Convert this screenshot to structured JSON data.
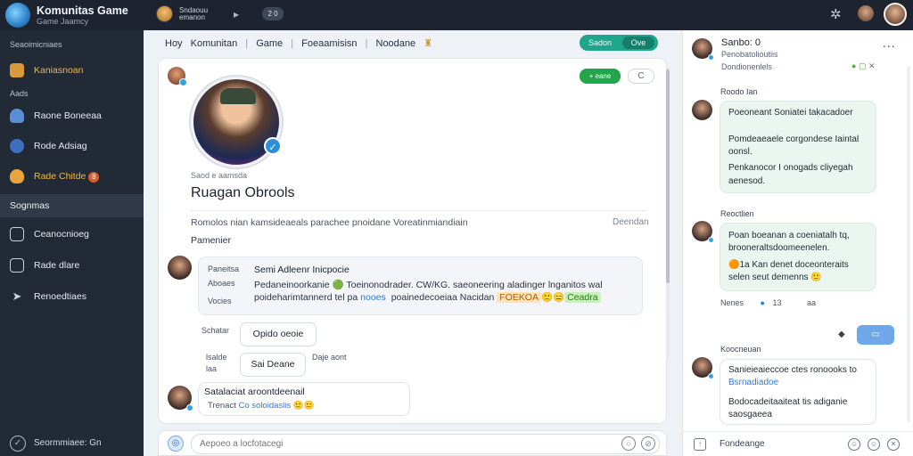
{
  "app": {
    "title": "Komunitas Game",
    "subtitle": "Game Jaamcy"
  },
  "topbar": {
    "user_line1": "Sndaouu",
    "user_line2": "emanon",
    "pill": "2 0"
  },
  "sidebar": {
    "section1": "Seaoimicniaes",
    "items1": [
      {
        "label": "Kaniasnoan",
        "icon": "controller-icon"
      }
    ],
    "section2": "Aads",
    "items2": [
      {
        "label": "Raone Boneeaa",
        "icon": "rocket-icon"
      },
      {
        "label": "Rode Adsiag",
        "icon": "globe-icon"
      },
      {
        "label": "Rade Chitde",
        "icon": "fire-icon",
        "badge": "8"
      }
    ],
    "active": "Sognmas",
    "items3": [
      {
        "label": "Ceanocnioeg",
        "icon": "monitor-icon"
      },
      {
        "label": "Rade dlare",
        "icon": "edit-icon"
      },
      {
        "label": "Renoedtiaes",
        "icon": "send-icon"
      }
    ],
    "footer": "Seormmiaee: Gn"
  },
  "breadcrumbs": [
    "Hoy",
    "Komunitan",
    "Game",
    "Foeaamisisn",
    "Noodane"
  ],
  "header_button": {
    "label": "Sadon",
    "split": "Ove"
  },
  "main": {
    "btn_green": "+ eane",
    "btn_refresh": "C",
    "room_meta": "Saod e aamsda",
    "room_title": "Ruagan Obrools",
    "room_desc": "Romolos nian kamsideaeals parachee pnoidane Voreatinmiandiain",
    "room_desc_right": "Deendan",
    "section": "Pamenier",
    "message1": {
      "side": [
        "Paneitsa",
        "Aboaes",
        "Vocies"
      ],
      "title": "Semi Adleenr Inicpocie",
      "line1": "Pedaneinoorkanie 🟢 Toeinonodrader. CW/KG. saeoneering aladinger lnganitos wal",
      "line2_pre": "poideharimtannerd tel pa",
      "line2_blue": "nooes",
      "line2_mid": " poainedecoeiaa Nacidan",
      "chip_orange": "FOEKOA",
      "line2_emoji": "🙂😑",
      "chip_green": "Ceadra"
    },
    "option1": {
      "label": "Schatar",
      "button": "Opido oeoie"
    },
    "option2": {
      "label1": "lsalde",
      "label2": "laa",
      "button": "Sai Deane"
    },
    "option_side": "Daje   aont",
    "message2": {
      "title": "Satalaciat aroontdeenail",
      "sub": "Trenact",
      "sub_blue": "Co soloidaslis",
      "emoji": "🙂🙂"
    },
    "input_placeholder": "Aepoeo a locfotacegi"
  },
  "right": {
    "name": "Sanbo: 0",
    "sub1": "Penobatolioutiis",
    "sub2": "Dondionenlels",
    "menu": "...",
    "icons": "● ▢ ✕",
    "thread1": {
      "label": "Roodo Ian",
      "lines": [
        "Poeoneant Soniatei takacadoer",
        "Pomdeaeaele corgondese Iaintal",
        "oonsl.",
        "Penkanocor I onogads cliyegah",
        "aenesod."
      ]
    },
    "thread2": {
      "label": "Reoctlien",
      "lines": [
        "Poan boeanan a coeniatalh tq,",
        "brooneraltsdoomeenelen.",
        "🟠1a Kan denet doceonteraits",
        "selen seut demenns 🙂"
      ]
    },
    "footer_row": {
      "left": "Nenes",
      "mid": "13",
      "right": "aa"
    },
    "tool": "▭",
    "thread3": {
      "label": "Koocneuan",
      "lines": [
        "Sanieieaieccoe ctes ronoooks to",
        "Bsrnadiadoe",
        "Bodocadeitaaiteat tis adiganie",
        "saosgaeea"
      ]
    },
    "input": "Fondeange"
  },
  "colors": {
    "accent": "#1fa58c",
    "green": "#23a54a",
    "sidebar": "#222a36"
  }
}
